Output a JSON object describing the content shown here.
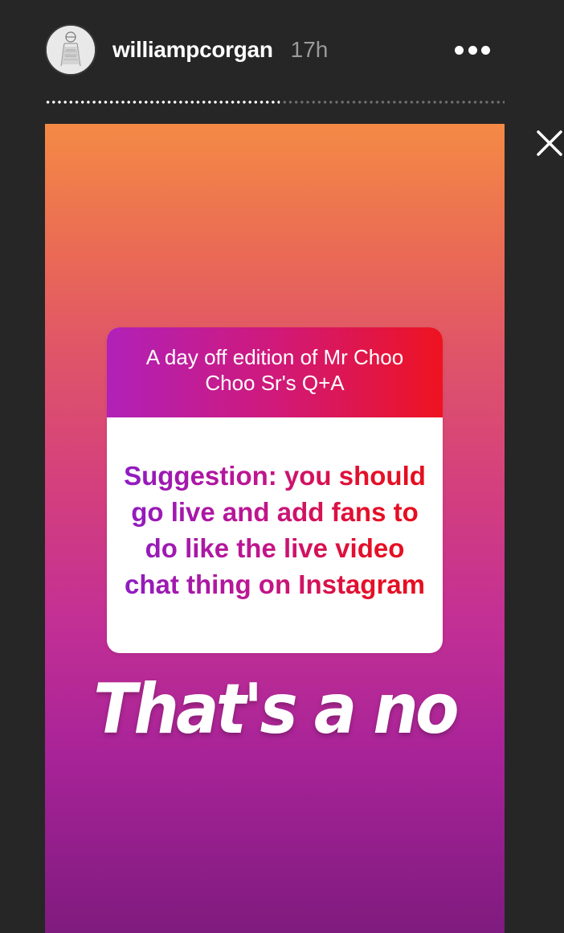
{
  "header": {
    "username": "williampcorgan",
    "timestamp": "17h",
    "avatar_icon": "avatar-sketch-icon",
    "more_icon": "more-options-icon"
  },
  "progress": {
    "segments_total": 2,
    "current_segment_progress": 0.51
  },
  "close_icon": "close-icon",
  "story": {
    "background_top": "#f48a45",
    "background_bottom": "#7f1b7f",
    "qa_sticker": {
      "prompt": "A day off edition of Mr Choo Choo Sr's Q+A",
      "question": "Suggestion: you should go live and add fans to do like the live video chat thing on Instagram",
      "header_gradient_start": "#b021b8",
      "header_gradient_end": "#ee1320"
    },
    "answer": "That's a no"
  }
}
